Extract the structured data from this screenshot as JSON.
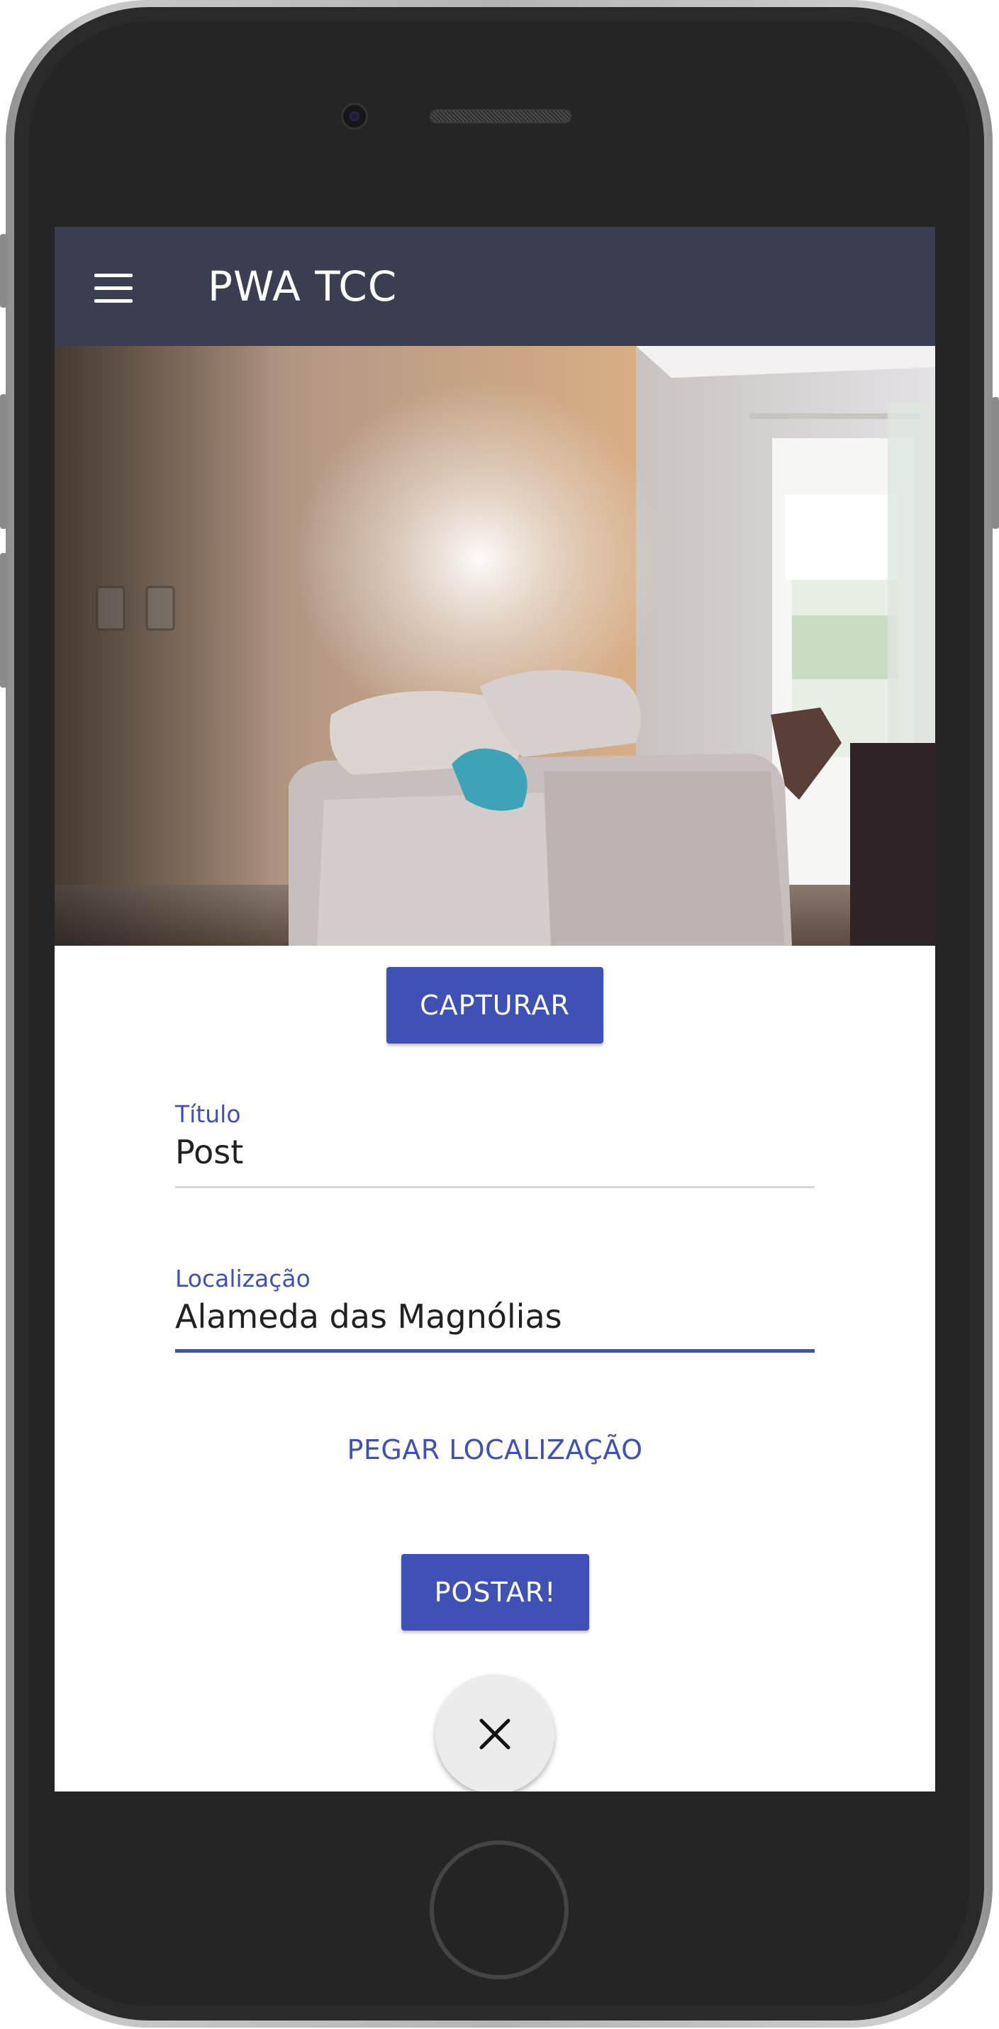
{
  "app": {
    "title": "PWA TCC",
    "accent_color": "#3f51b5",
    "toolbar_color": "#3b3e50"
  },
  "toolbar": {
    "menu_icon": "hamburger-menu-icon",
    "title": "PWA TCC"
  },
  "camera": {
    "capture_label": "CAPTURAR"
  },
  "form": {
    "title_field": {
      "label": "Título",
      "value": "Post"
    },
    "location_field": {
      "label": "Localização",
      "value": "Alameda das Magnólias"
    },
    "get_location_label": "PEGAR LOCALIZAÇÃO",
    "post_label": "POSTAR!",
    "close_icon": "close-icon"
  }
}
